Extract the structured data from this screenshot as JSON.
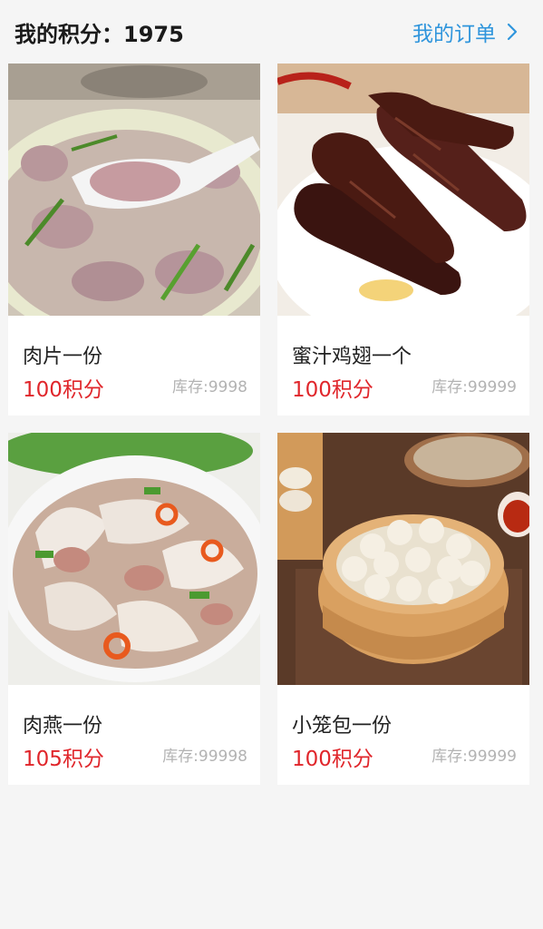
{
  "header": {
    "points_text": "我的积分：1975",
    "orders_label": "我的订单"
  },
  "products": [
    {
      "name": "肉片一份",
      "price": "100积分",
      "stock": "库存:9998",
      "image_icon": "meat-slice-soup-image"
    },
    {
      "name": "蜜汁鸡翅一个",
      "price": "100积分",
      "stock": "库存:99999",
      "image_icon": "honey-chicken-wings-image"
    },
    {
      "name": "肉燕一份",
      "price": "105积分",
      "stock": "库存:99998",
      "image_icon": "rouyan-wonton-image"
    },
    {
      "name": "小笼包一份",
      "price": "100积分",
      "stock": "库存:99999",
      "image_icon": "xiaolongbao-image"
    }
  ],
  "colors": {
    "accent": "#2f95dc",
    "price": "#e0262b",
    "stock": "#b3b3b3",
    "background": "#f5f5f5"
  }
}
